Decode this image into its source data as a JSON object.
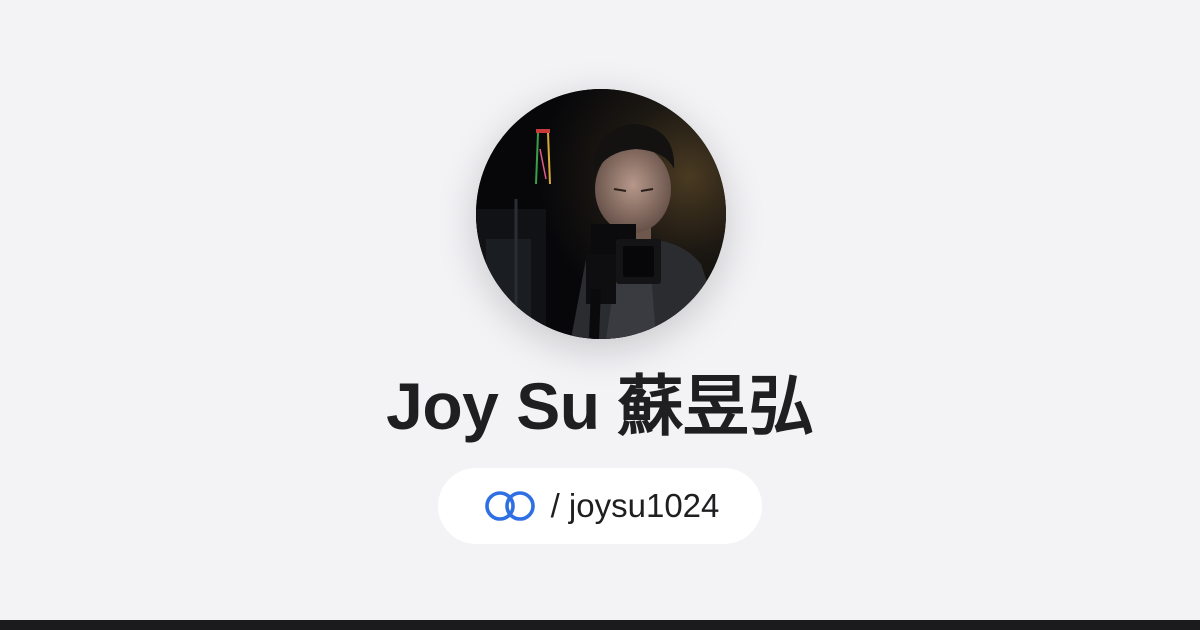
{
  "profile": {
    "name": "Joy Su 蘇昱弘",
    "handle": "/ joysu1024",
    "avatar_icon": "profile-photo",
    "link_icon": "linked-rings-icon"
  },
  "colors": {
    "background": "#f3f3f6",
    "pill": "#ffffff",
    "text": "#1f1f22",
    "link_icon_blue": "#2f6fe4",
    "footer": "#1b1b1e"
  }
}
